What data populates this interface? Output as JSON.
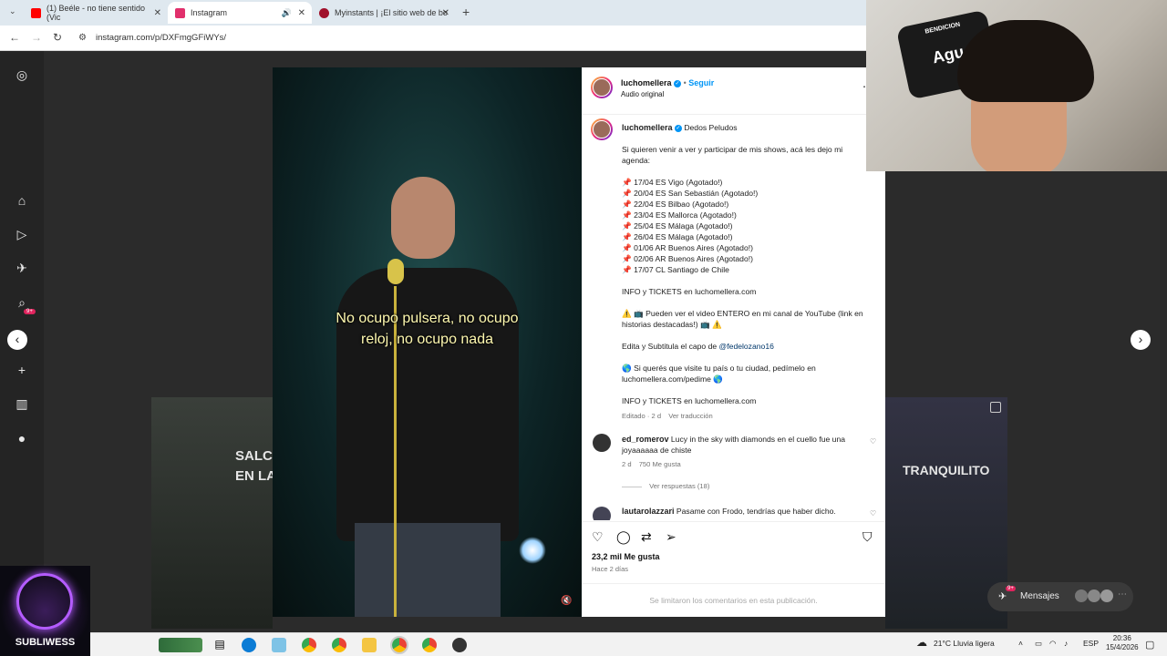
{
  "browser": {
    "tabs": [
      {
        "title": "(1) Beéle - no tiene sentido (Vic",
        "favicon_color": "#ff0000"
      },
      {
        "title": "Instagram",
        "favicon_color": "#e1306c"
      },
      {
        "title": "Myinstants | ¡El sitio web de bo",
        "favicon_color": "#a0102a"
      }
    ],
    "url": "instagram.com/p/DXFmgGFiWYs/"
  },
  "video": {
    "caption": "No ocupo pulsera, no ocupo reloj, no ocupo nada"
  },
  "background_posts": {
    "left_text": "SALC\nEN LA",
    "right_text": "TRANQUILITO"
  },
  "post_header": {
    "username": "luchomellera",
    "follow_label": "Seguir",
    "audio": "Audio original"
  },
  "caption": {
    "username": "luchomellera",
    "title": "Dedos Peludos",
    "intro": "Si quieren venir a ver y participar de mis shows, acá les dejo mi agenda:",
    "dates": [
      "📌 17/04 ES Vigo (Agotado!)",
      "📌 20/04 ES San Sebastián (Agotado!)",
      "📌 22/04 ES Bilbao (Agotado!)",
      "📌 23/04 ES Mallorca (Agotado!)",
      "📌 25/04 ES Málaga (Agotado!)",
      "📌 26/04 ES Málaga (Agotado!)",
      "📌 01/06 AR Buenos Aires (Agotado!)",
      "📌 02/06 AR Buenos Aires (Agotado!)",
      "📌 17/07 CL Santiago de Chile"
    ],
    "info1": "INFO y TICKETS en luchomellera.com",
    "youtube": "⚠️ 📺 Pueden ver el video ENTERO en mi canal de YouTube (link en historias destacadas!) 📺 ⚠️",
    "edit_prefix": "Edita y Subtitula el capo de",
    "edit_handle": "@fedelozano16",
    "visit": "🌎 Si querés que visite tu país o tu ciudad, pedímelo en luchomellera.com/pedime 🌎",
    "info2": "INFO y TICKETS en luchomellera.com",
    "meta": "Editado · 2 d",
    "translate": "Ver traducción"
  },
  "comments": [
    {
      "user": "ed_romerov",
      "text": "Lucy in the sky with diamonds en el cuello fue una joyaaaaaa de chiste",
      "age": "2 d",
      "likes": "750 Me gusta",
      "replies": "Ver respuestas (18)"
    },
    {
      "user": "lautarolazzari",
      "text": "Pasame con Frodo, tendrías que haber dicho."
    }
  ],
  "stats": {
    "likes": "23,2 mil Me gusta",
    "ago": "Hace 2 días",
    "limited": "Se limitaron los comentarios en esta publicación."
  },
  "messages": {
    "label": "Mensajes",
    "badge": "9+"
  },
  "sidebar": {
    "badge": "9+"
  },
  "webcam": {
    "logo_text": "Agu",
    "banner": "BENDICION"
  },
  "stream_logo": {
    "text": "SUBLIWESS"
  },
  "taskbar": {
    "weather": "21°C  Lluvia ligera",
    "lang": "ESP",
    "time": "20:36",
    "date": "15/4/2026"
  }
}
